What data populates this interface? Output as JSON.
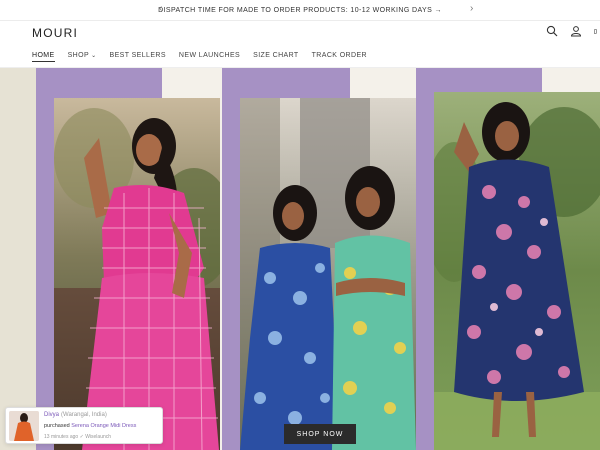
{
  "announcement": {
    "text": "DISPATCH TIME FOR MADE TO ORDER PRODUCTS: 10-12 WORKING DAYS →",
    "prev_icon": "chevron-left-icon",
    "next_icon": "chevron-right-icon"
  },
  "header": {
    "logo": "MOURI",
    "nav": [
      {
        "label": "HOME",
        "active": true
      },
      {
        "label": "SHOP",
        "dropdown": true
      },
      {
        "label": "BEST SELLERS"
      },
      {
        "label": "NEW LAUNCHES"
      },
      {
        "label": "SIZE CHART"
      },
      {
        "label": "TRACK ORDER"
      }
    ],
    "icons": [
      "search-icon",
      "account-icon",
      "cart-icon"
    ]
  },
  "hero": {
    "cta_label": "SHOP NOW",
    "accent_color": "#a691c4",
    "background_color": "#f4f1ea"
  },
  "purchase_toast": {
    "name": "Divya",
    "location": "(Warangal, India)",
    "action": "purchased",
    "product": "Serena Orange Midi Dress",
    "time": "13 minutes ago",
    "source": "Wiselaunch"
  }
}
